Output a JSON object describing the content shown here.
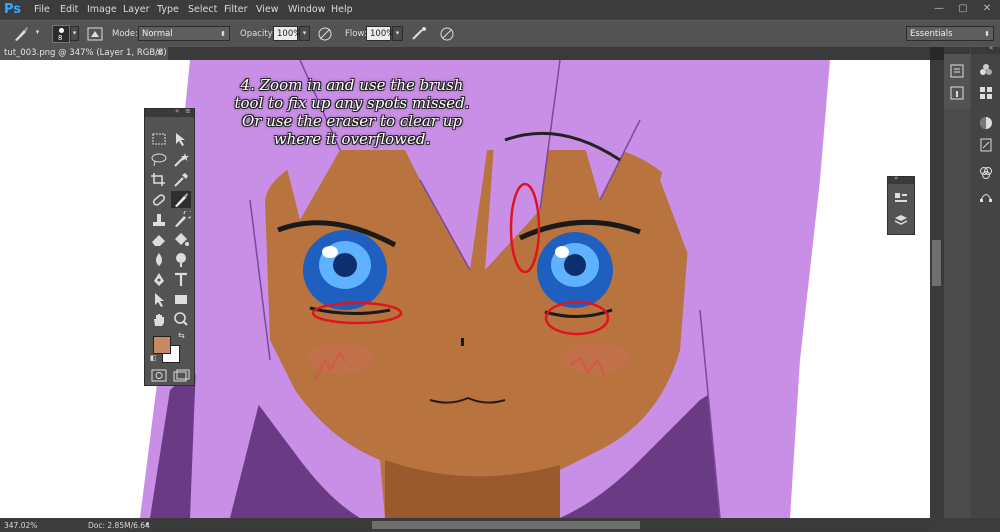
{
  "app": {
    "logo": "Ps"
  },
  "menu": [
    "File",
    "Edit",
    "Image",
    "Layer",
    "Type",
    "Select",
    "Filter",
    "View",
    "Window",
    "Help"
  ],
  "window_controls": {
    "minimize": "—",
    "restore": "▢",
    "close": "✕"
  },
  "options": {
    "brush_size": "8",
    "mode_label": "Mode:",
    "mode_value": "Normal",
    "opacity_label": "Opacity:",
    "opacity_value": "100%",
    "flow_label": "Flow:",
    "flow_value": "100%",
    "workspace": "Essentials"
  },
  "document_tab": {
    "title": "tut_003.png @ 347% (Layer 1, RGB/8) *",
    "close": "×"
  },
  "annotation": {
    "lines": [
      "4. Zoom in and use the brush",
      "tool to fix up any spots missed.",
      "Or use the eraser to clear up",
      "where it overflowed."
    ]
  },
  "status": {
    "zoom": "347.02%",
    "doc": "Doc: 2.85M/6.64M"
  },
  "colors": {
    "foreground": "#c48a63",
    "background": "#ffffff",
    "accent": "#31a8ff",
    "highlight_circle": "#e0141e",
    "hair": "#c98ee6",
    "skin": "#b8733e"
  }
}
